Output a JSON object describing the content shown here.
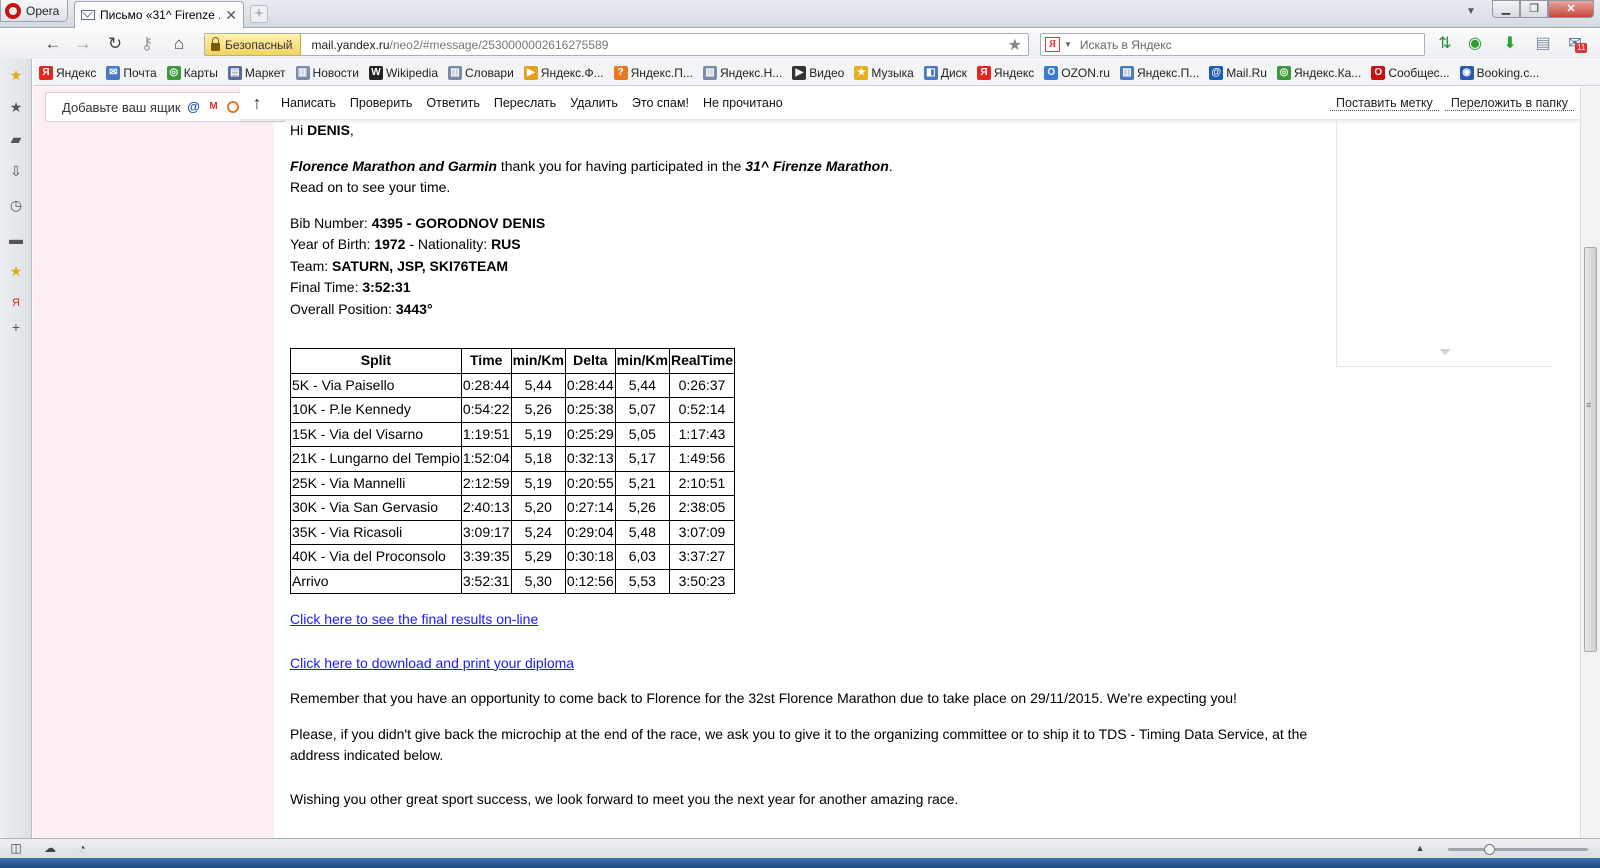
{
  "browser": {
    "menu_label": "Opera",
    "tab_title": "Письмо «31^ Firenze ...",
    "url_host": "mail.yandex.ru",
    "url_path": "/neo2/#message/2530000002616275589",
    "security_label": "Безопасный",
    "search_placeholder": "Искать в Яндекс",
    "search_engine_letter": "Я",
    "notification_count": "11"
  },
  "bookmarks": [
    {
      "label": "Яндекс",
      "icon": "yandex-icon",
      "color": "#e52620",
      "glyph": "Я"
    },
    {
      "label": "Почта",
      "icon": "mail-icon",
      "color": "#4a78c2",
      "glyph": "✉"
    },
    {
      "label": "Карты",
      "icon": "maps-icon",
      "color": "#3a9a3a",
      "glyph": "◎"
    },
    {
      "label": "Маркет",
      "icon": "market-icon",
      "color": "#5a6a9a",
      "glyph": "▤"
    },
    {
      "label": "Новости",
      "icon": "news-icon",
      "color": "#7a8aa8",
      "glyph": "▥"
    },
    {
      "label": "Wikipedia",
      "icon": "wikipedia-icon",
      "color": "#222222",
      "glyph": "W"
    },
    {
      "label": "Словари",
      "icon": "dictionary-icon",
      "color": "#7a8aa8",
      "glyph": "▥"
    },
    {
      "label": "Яндекс.Ф...",
      "icon": "fotki-icon",
      "color": "#e5a020",
      "glyph": "▶"
    },
    {
      "label": "Яндекс.П...",
      "icon": "yandex-p-icon",
      "color": "#e57a20",
      "glyph": "?"
    },
    {
      "label": "Яндекс.Н...",
      "icon": "yandex-n-icon",
      "color": "#7a8aa8",
      "glyph": "▥"
    },
    {
      "label": "Видео",
      "icon": "video-icon",
      "color": "#333333",
      "glyph": "▶"
    },
    {
      "label": "Музыка",
      "icon": "music-star-icon",
      "color": "#e5b020",
      "glyph": "★"
    },
    {
      "label": "Диск",
      "icon": "disk-icon",
      "color": "#4a78c2",
      "glyph": "◧"
    },
    {
      "label": "Яндекс",
      "icon": "yandex-icon-2",
      "color": "#e52620",
      "glyph": "Я"
    },
    {
      "label": "OZON.ru",
      "icon": "ozon-icon",
      "color": "#3a7ad8",
      "glyph": "O"
    },
    {
      "label": "Яндекс.П...",
      "icon": "yandex-p2-icon",
      "color": "#4a78c2",
      "glyph": "▥"
    },
    {
      "label": "Mail.Ru",
      "icon": "mailru-icon",
      "color": "#1a5ab8",
      "glyph": "@"
    },
    {
      "label": "Яндекс.Ка...",
      "icon": "yandex-ka-icon",
      "color": "#3a9a3a",
      "glyph": "◎"
    },
    {
      "label": "Сообщес...",
      "icon": "opera-community-icon",
      "color": "#cc1010",
      "glyph": "O"
    },
    {
      "label": "Booking.c...",
      "icon": "booking-icon",
      "color": "#2a5ab0",
      "glyph": "◉"
    }
  ],
  "sidebar": {
    "add_mailbox_label": "Добавьте ваш ящик"
  },
  "mail_toolbar": {
    "compose": "Написать",
    "check": "Проверить",
    "reply": "Ответить",
    "forward": "Переслать",
    "delete": "Удалить",
    "spam": "Это спам!",
    "unread": "Не прочитано",
    "label": "Поставить метку",
    "move": "Переложить в папку"
  },
  "email": {
    "greeting_prefix": "Hi ",
    "name": "DENIS",
    "greeting_suffix": ",",
    "sponsors": "Florence Marathon and Garmin",
    "thanks_mid": " thank you for having participated in the ",
    "event_name": "31^ Firenze Marathon",
    "thanks_end": ".",
    "read_on": "Read on to see your time.",
    "bib_label": "Bib Number: ",
    "bib_value": "4395 - GORODNOV DENIS",
    "yob_label": "Year of Birth: ",
    "yob_value": "1972",
    "nat_sep": " - Nationality: ",
    "nat_value": "RUS",
    "team_label": "Team: ",
    "team_value": "SATURN, JSP, SKI76TEAM",
    "final_label": "Final Time: ",
    "final_value": "3:52:31",
    "position_label": "Overall Position: ",
    "position_value": "3443°",
    "results_link": "Click here to see the final results on-line",
    "diploma_link": "Click here to download and print your diploma",
    "remember_text": "Remember that you have an opportunity to come back to Florence for the 32st Florence Marathon due to take place on 29/11/2015. We're expecting you!",
    "microchip_text": "Please, if you didn't give back the microchip at the end of the race, we ask you to give it to the organizing committee or to ship it to TDS - Timing Data Service, at the address indicated below.",
    "wishing_text": "Wishing you other great sport success, we look forward to meet you the next year for another amazing race."
  },
  "splits_table": {
    "headers": [
      "Split",
      "Time",
      "min/Km",
      "Delta",
      "min/Km",
      "RealTime"
    ],
    "rows": [
      [
        "5K - Via Paisello",
        "0:28:44",
        "5,44",
        "0:28:44",
        "5,44",
        "0:26:37"
      ],
      [
        "10K - P.le Kennedy",
        "0:54:22",
        "5,26",
        "0:25:38",
        "5,07",
        "0:52:14"
      ],
      [
        "15K - Via del Visarno",
        "1:19:51",
        "5,19",
        "0:25:29",
        "5,05",
        "1:17:43"
      ],
      [
        "21K - Lungarno del Tempio",
        "1:52:04",
        "5,18",
        "0:32:13",
        "5,17",
        "1:49:56"
      ],
      [
        "25K - Via Mannelli",
        "2:12:59",
        "5,19",
        "0:20:55",
        "5,21",
        "2:10:51"
      ],
      [
        "30K - Via San Gervasio",
        "2:40:13",
        "5,20",
        "0:27:14",
        "5,26",
        "2:38:05"
      ],
      [
        "35K - Via Ricasoli",
        "3:09:17",
        "5,24",
        "0:29:04",
        "5,48",
        "3:07:09"
      ],
      [
        "40K - Via del Proconsolo",
        "3:39:35",
        "5,29",
        "0:30:18",
        "6,03",
        "3:37:27"
      ],
      [
        "Arrivo",
        "3:52:31",
        "5,30",
        "0:12:56",
        "5,53",
        "3:50:23"
      ]
    ]
  },
  "colors": {
    "sidebar_bg": "#fdeef3",
    "link": "#1a1aff",
    "secure_badge": "#f2d45c"
  }
}
